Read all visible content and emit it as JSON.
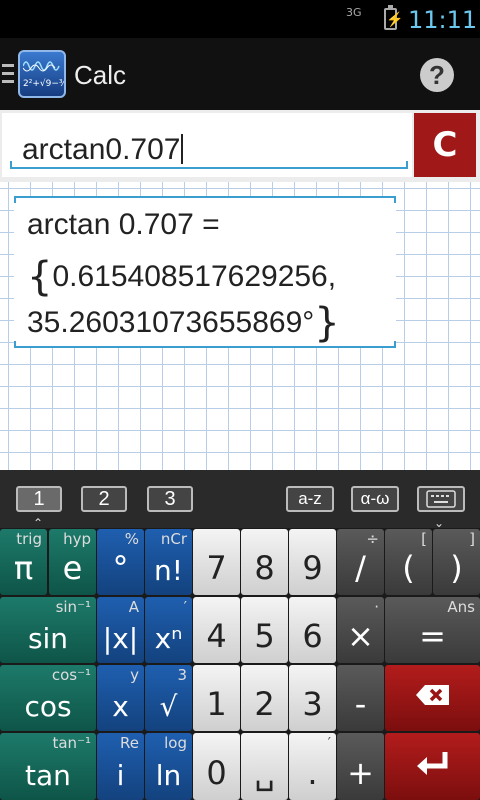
{
  "status_bar": {
    "network": "3G",
    "time": "11:11",
    "battery_icon": "battery-charging-icon"
  },
  "action_bar": {
    "title": "Calc",
    "app_icon_formula": "2²+√9−¾",
    "help_label": "?"
  },
  "input": {
    "value": "arctan0.707",
    "clear_label": "C"
  },
  "result": {
    "line1": "arctan 0.707 =",
    "line2": "0.615408517629256,",
    "line3": "35.26031073655869°",
    "open_brace": "{",
    "close_brace": "}"
  },
  "keyboard_tabs": {
    "tab1": "1",
    "tab2": "2",
    "tab3": "3",
    "tab_az": "a-z",
    "tab_greek": "α-ω",
    "tab_keyboard_icon": "keyboard-icon"
  },
  "keys": {
    "pi": {
      "main": "π",
      "sub": "trig"
    },
    "e": {
      "main": "e",
      "sub": "hyp"
    },
    "degree": {
      "main": "°",
      "sub": "%"
    },
    "factorial": {
      "main": "n!",
      "sub": "nCr"
    },
    "seven": {
      "main": "7"
    },
    "eight": {
      "main": "8"
    },
    "nine": {
      "main": "9"
    },
    "divide": {
      "main": "/",
      "sub": "÷"
    },
    "open_paren": {
      "main": "(",
      "sub": "["
    },
    "close_paren": {
      "main": ")",
      "sub": "]"
    },
    "sin": {
      "main": "sin",
      "sub": "sin⁻¹"
    },
    "abs": {
      "main": "|x|",
      "sub": "A"
    },
    "power": {
      "main": "xⁿ",
      "sub": "′"
    },
    "four": {
      "main": "4"
    },
    "five": {
      "main": "5"
    },
    "six": {
      "main": "6"
    },
    "multiply": {
      "main": "×",
      "sub": "·"
    },
    "equals": {
      "main": "=",
      "sub": "Ans"
    },
    "cos": {
      "main": "cos",
      "sub": "cos⁻¹"
    },
    "x": {
      "main": "x",
      "sub": "y"
    },
    "sqrt": {
      "main": "√",
      "sub": "3"
    },
    "one": {
      "main": "1"
    },
    "two": {
      "main": "2"
    },
    "three": {
      "main": "3"
    },
    "minus": {
      "main": "-"
    },
    "backspace": {
      "main": "⌫"
    },
    "tan": {
      "main": "tan",
      "sub": "tan⁻¹"
    },
    "i": {
      "main": "i",
      "sub": "Re"
    },
    "ln": {
      "main": "ln",
      "sub": "log"
    },
    "zero": {
      "main": "0"
    },
    "space": {
      "main": "␣"
    },
    "decimal": {
      "main": ".",
      "sub": "′"
    },
    "plus": {
      "main": "+"
    },
    "enter": {
      "main": "↵"
    }
  }
}
